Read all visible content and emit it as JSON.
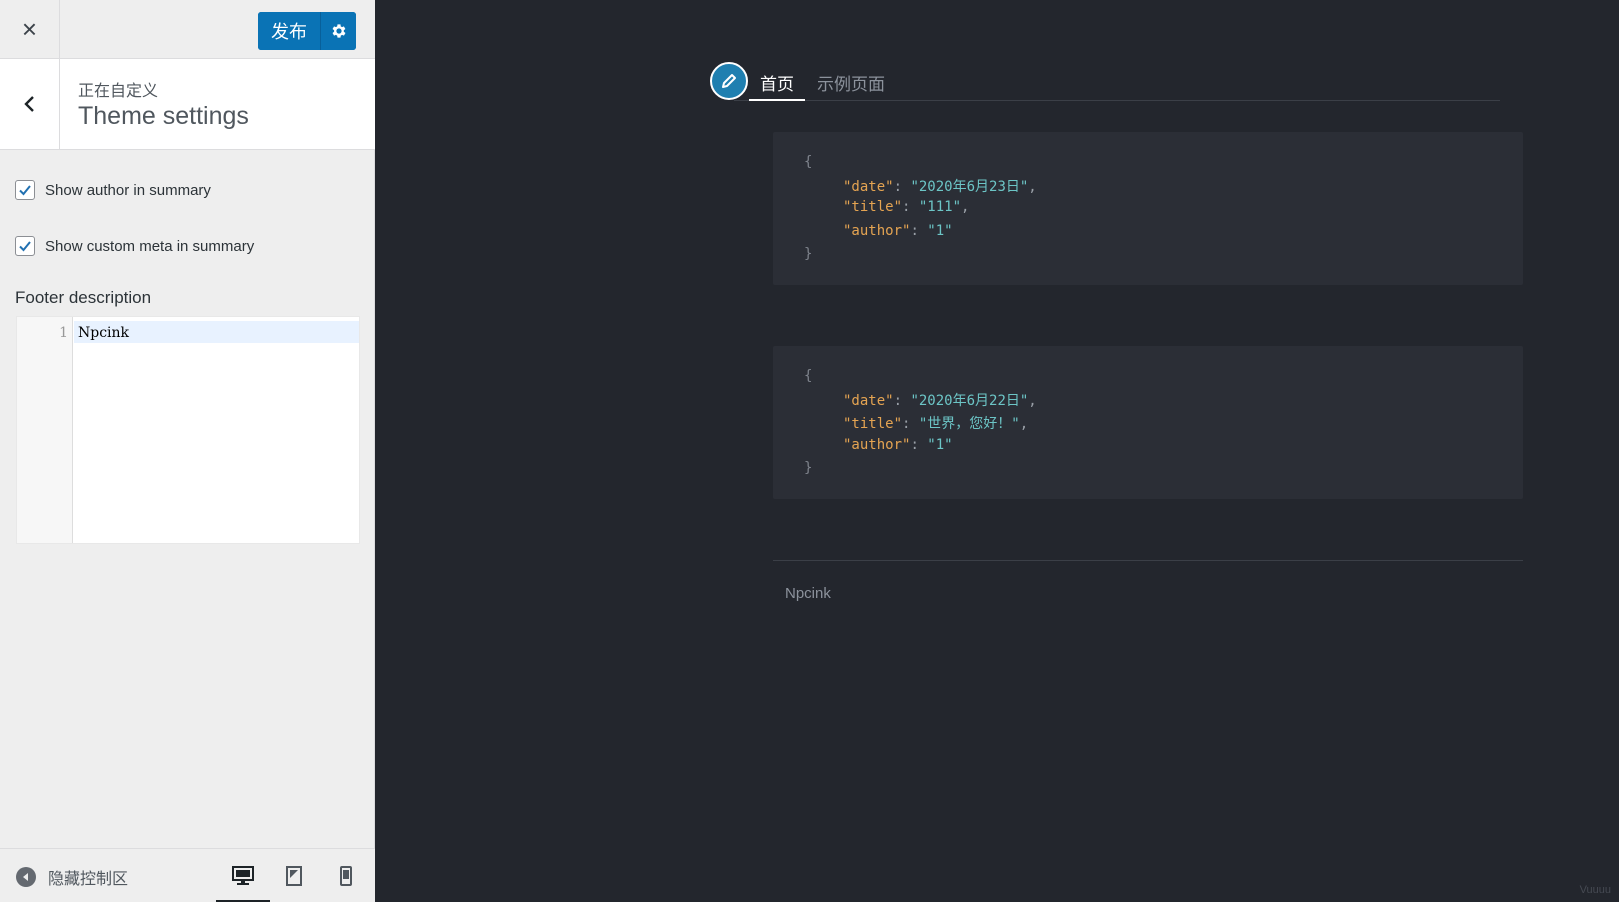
{
  "sidebar": {
    "close_label": "×",
    "publish_label": "发布",
    "section": {
      "subtitle": "正在自定义",
      "title": "Theme settings"
    },
    "checkboxes": [
      {
        "label": "Show author in summary",
        "checked": true
      },
      {
        "label": "Show custom meta in summary",
        "checked": true
      }
    ],
    "footer_field": {
      "label": "Footer description",
      "line_number": "1",
      "value": "Npcink"
    },
    "footer": {
      "hide_label": "隐藏控制区",
      "devices": [
        "desktop-icon",
        "tablet-icon",
        "mobile-icon"
      ],
      "active_device": "desktop"
    }
  },
  "preview": {
    "nav": {
      "tabs": [
        {
          "label": "首页",
          "active": true
        },
        {
          "label": "示例页面",
          "active": false
        }
      ]
    },
    "posts": [
      {
        "open": "{",
        "date_key": "\"date\"",
        "date_val": "\"2020年6月23日\"",
        "title_key": "\"title\"",
        "title_val": "\"111\"",
        "author_key": "\"author\"",
        "author_val": "\"1\"",
        "close": "}"
      },
      {
        "open": "{",
        "date_key": "\"date\"",
        "date_val": "\"2020年6月22日\"",
        "title_key": "\"title\"",
        "title_val": "\"世界，您好！\"",
        "author_key": "\"author\"",
        "author_val": "\"1\"",
        "close": "}"
      }
    ],
    "footer_text": "Npcink",
    "watermark": "Vuuuu"
  },
  "colors": {
    "accent": "#0a73b5",
    "preview_bg": "#23262d",
    "card_bg": "#2b2e36",
    "json_key": "#e5a452",
    "json_string": "#6cc5c6"
  }
}
